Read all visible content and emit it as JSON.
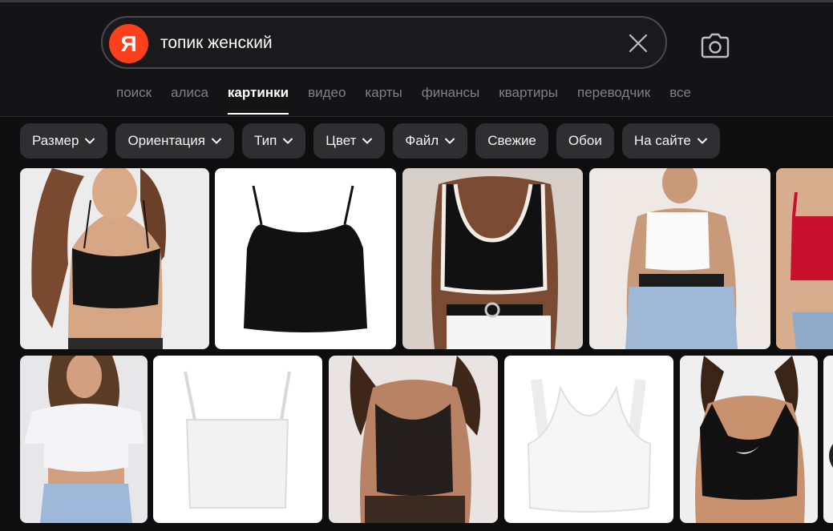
{
  "search": {
    "logo_letter": "Я",
    "query": "топик женский"
  },
  "tabs": [
    {
      "label": "поиск",
      "active": false
    },
    {
      "label": "алиса",
      "active": false
    },
    {
      "label": "картинки",
      "active": true
    },
    {
      "label": "видео",
      "active": false
    },
    {
      "label": "карты",
      "active": false
    },
    {
      "label": "финансы",
      "active": false
    },
    {
      "label": "квартиры",
      "active": false
    },
    {
      "label": "переводчик",
      "active": false
    },
    {
      "label": "все",
      "active": false
    }
  ],
  "filters": [
    {
      "label": "Размер",
      "dropdown": true
    },
    {
      "label": "Ориентация",
      "dropdown": true
    },
    {
      "label": "Тип",
      "dropdown": true
    },
    {
      "label": "Цвет",
      "dropdown": true
    },
    {
      "label": "Файл",
      "dropdown": true
    },
    {
      "label": "Свежие",
      "dropdown": false
    },
    {
      "label": "Обои",
      "dropdown": false
    },
    {
      "label": "На сайте",
      "dropdown": true
    }
  ],
  "colors": {
    "brand": "#fc3f1d",
    "background": "#0e0e0f",
    "chip": "#2f2f32",
    "tab_inactive": "#808085"
  },
  "results": [
    {
      "subject": "black crop cami on model"
    },
    {
      "subject": "black crop cami product"
    },
    {
      "subject": "black tank with white trim on model"
    },
    {
      "subject": "white bandeau cami on model"
    },
    {
      "subject": "red cami on model"
    },
    {
      "subject": "white crop t-shirt on model"
    },
    {
      "subject": "white bandeau cami product"
    },
    {
      "subject": "black mesh cami on model"
    },
    {
      "subject": "white ribbed tank product"
    },
    {
      "subject": "black sports bra on model"
    },
    {
      "subject": "partial image"
    }
  ]
}
